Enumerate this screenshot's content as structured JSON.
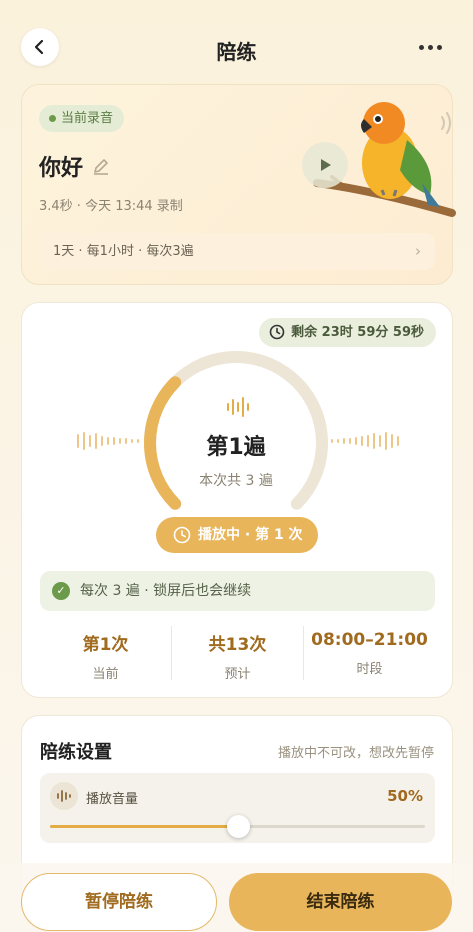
{
  "header": {
    "title": "陪练"
  },
  "recording": {
    "badge": "当前录音",
    "title": "你好",
    "meta": "3.4秒 · 今天 13:44 录制",
    "schedule": "1天 · 每1小时 · 每次3遍"
  },
  "session": {
    "remaining": "剩余 23时 59分 59秒",
    "count_prefix": "第",
    "count_number": "1",
    "count_suffix": "遍",
    "total_text": "本次共 3 遍",
    "progress_fraction": 0.3333,
    "playing_label": "播放中 · 第 1 次",
    "continue_note": "每次 3 遍 · 锁屏后也会继续",
    "stats": [
      {
        "value": "第1次",
        "label": "当前"
      },
      {
        "value": "共13次",
        "label": "预计"
      },
      {
        "value": "08:00–21:00",
        "label": "时段"
      }
    ]
  },
  "settings": {
    "title": "陪练设置",
    "note": "播放中不可改，想改先暂停",
    "volume_label": "播放音量",
    "volume_value": "50%",
    "volume_fraction": 0.5
  },
  "actions": {
    "pause": "暂停陪练",
    "end": "结束陪练"
  },
  "colors": {
    "accent": "#e8b55a",
    "accent_dark": "#a06a1f",
    "success": "#6a9a4a"
  },
  "icons": [
    "back-icon",
    "more-icon",
    "edit-icon",
    "play-icon",
    "sound-icon",
    "clock-icon",
    "waveform-icon",
    "check-icon",
    "chevron-right-icon"
  ]
}
